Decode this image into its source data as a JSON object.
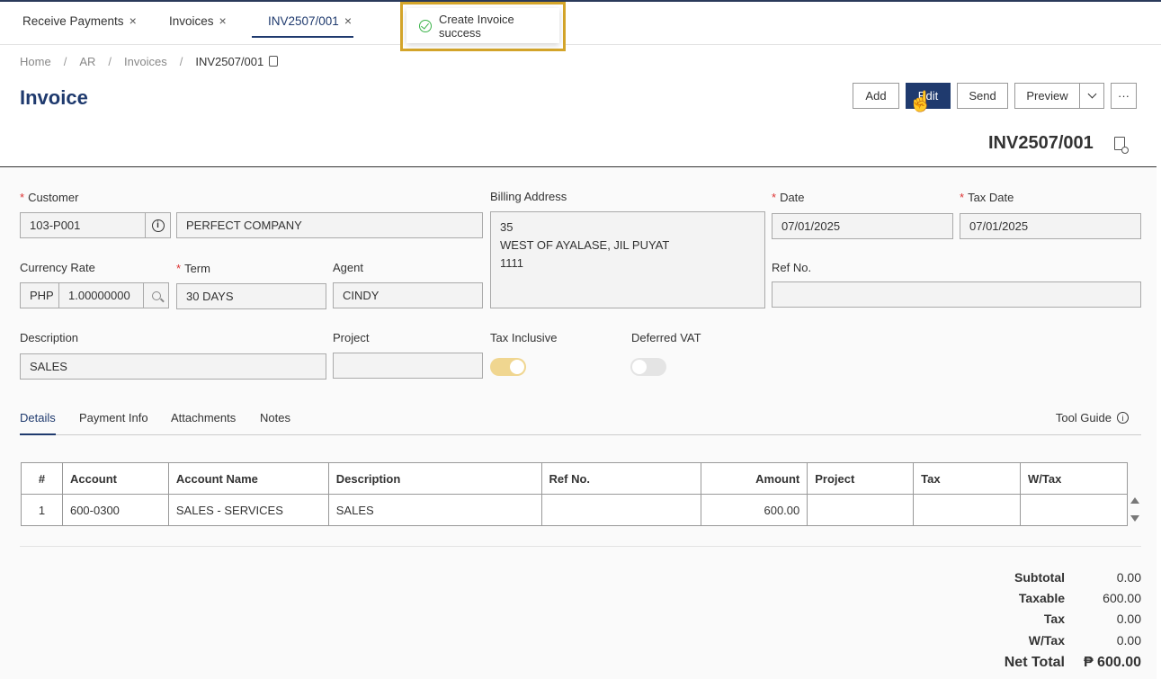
{
  "tabs": [
    {
      "label": "Receive Payments",
      "close": "×"
    },
    {
      "label": "Invoices",
      "close": "×"
    },
    {
      "label": "INV2507/001",
      "close": "×"
    }
  ],
  "toast": {
    "message": "Create Invoice success",
    "status_color": "#3bb34a"
  },
  "breadcrumb": {
    "home": "Home",
    "ar": "AR",
    "invoices": "Invoices",
    "current": "INV2507/001",
    "separator": "/"
  },
  "page": {
    "title": "Invoice",
    "doc_number": "INV2507/001"
  },
  "toolbar": {
    "add": "Add",
    "edit": "Edit",
    "send": "Send",
    "preview": "Preview",
    "more": "···"
  },
  "form": {
    "customer_label": "Customer",
    "customer_code": "103-P001",
    "customer_name": "PERFECT COMPANY",
    "billing_label": "Billing Address",
    "billing_line1": "35",
    "billing_line2": "WEST OF AYALASE, JIL PUYAT",
    "billing_line3": "1111",
    "date_label": "Date",
    "date_value": "07/01/2025",
    "taxdate_label": "Tax Date",
    "taxdate_value": "07/01/2025",
    "currency_label": "Currency Rate",
    "currency_code": "PHP",
    "currency_rate": "1.00000000",
    "term_label": "Term",
    "term_value": "30 DAYS",
    "agent_label": "Agent",
    "agent_value": "CINDY",
    "refno_label": "Ref No.",
    "refno_value": "",
    "description_label": "Description",
    "description_value": "SALES",
    "project_label": "Project",
    "project_value": "",
    "tax_inclusive_label": "Tax Inclusive",
    "tax_inclusive_on": true,
    "deferred_vat_label": "Deferred VAT",
    "deferred_vat_on": false,
    "required_mark": "*"
  },
  "detail_tabs": {
    "details": "Details",
    "payment_info": "Payment Info",
    "attachments": "Attachments",
    "notes": "Notes",
    "tool_guide": "Tool Guide"
  },
  "table": {
    "headers": [
      "#",
      "Account",
      "Account Name",
      "Description",
      "Ref No.",
      "Amount",
      "Project",
      "Tax",
      "W/Tax"
    ],
    "rows": [
      [
        "1",
        "600-0300",
        "SALES - SERVICES",
        "SALES",
        "",
        "600.00",
        "",
        "",
        ""
      ]
    ]
  },
  "totals": {
    "subtotal_label": "Subtotal",
    "subtotal": "0.00",
    "taxable_label": "Taxable",
    "taxable": "600.00",
    "tax_label": "Tax",
    "tax": "0.00",
    "wtax_label": "W/Tax",
    "wtax": "0.00",
    "net_label": "Net Total",
    "net": "₱ 600.00"
  },
  "colors": {
    "brand": "#1f3a6e",
    "highlight": "#d4a52a",
    "toggle_on": "#f0d690",
    "toggle_off": "#e4e4e4"
  }
}
